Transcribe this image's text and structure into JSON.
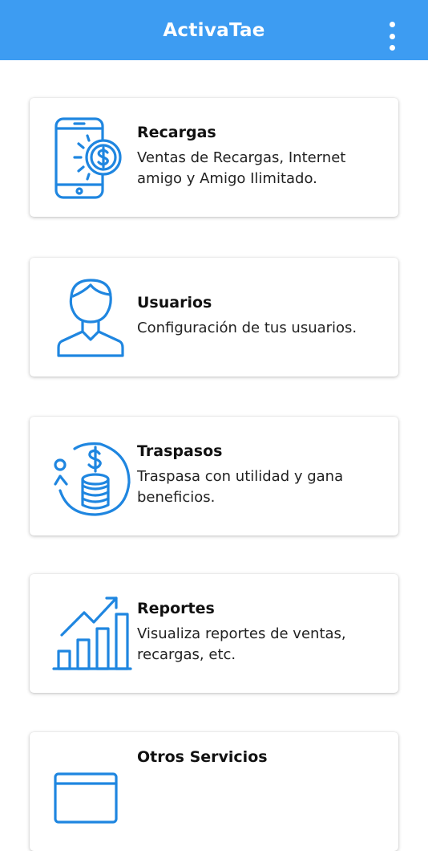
{
  "appbar": {
    "title": "ActivaTae",
    "menu_icon": "more-vert-icon"
  },
  "colors": {
    "primary": "#3d9cf2",
    "icon": "#1f86e0"
  },
  "cards": [
    {
      "title": "Recargas",
      "description": "Ventas de Recargas, Internet amigo y Amigo Ilimitado.",
      "icon": "phone-dollar-icon"
    },
    {
      "title": "Usuarios",
      "description": "Configuración de tus usuarios.",
      "icon": "user-icon"
    },
    {
      "title": "Traspasos",
      "description": "Traspasa con utilidad y gana beneficios.",
      "icon": "coins-transfer-icon"
    },
    {
      "title": "Reportes",
      "description": "Visualiza reportes de ventas, recargas, etc.",
      "icon": "bar-chart-icon"
    },
    {
      "title": "Otros Servicios",
      "description": "",
      "icon": "card-icon"
    }
  ]
}
